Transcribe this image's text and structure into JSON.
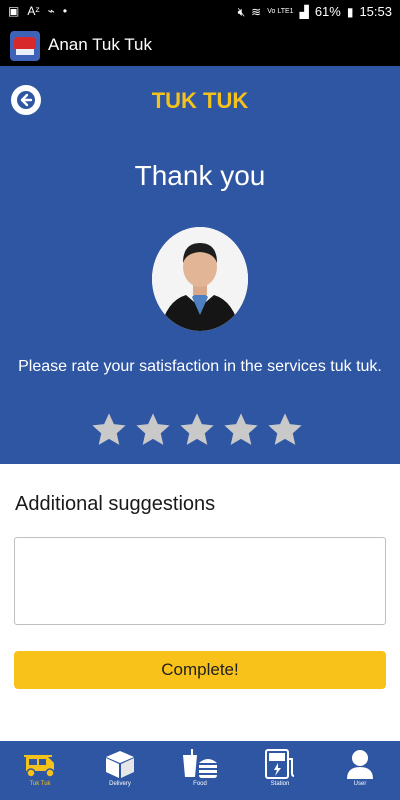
{
  "status_bar": {
    "battery": "61%",
    "time": "15:53",
    "network": "Vo LTE1"
  },
  "app_bar": {
    "title": "Anan Tuk Tuk",
    "logo_icon": "app-logo-icon"
  },
  "hero": {
    "brand_title": "TUK TUK",
    "thank_you": "Thank you",
    "rating_prompt": "Please rate your satisfaction in the services tuk tuk.",
    "rating": 0,
    "max_rating": 5,
    "star_color": "#c9c9c9",
    "background": "#2f56a2",
    "accent": "#f4c21a"
  },
  "suggestions": {
    "label": "Additional suggestions",
    "value": "",
    "placeholder": ""
  },
  "complete_button": {
    "label": "Complete!",
    "color": "#f9c21a"
  },
  "bottom_nav": {
    "items": [
      {
        "label": "Tuk Tuk",
        "icon": "tuk-tuk-icon",
        "active": true
      },
      {
        "label": "Delivery",
        "icon": "delivery-box-icon",
        "active": false
      },
      {
        "label": "Food",
        "icon": "food-icon",
        "active": false
      },
      {
        "label": "Station",
        "icon": "station-icon",
        "active": false
      },
      {
        "label": "User",
        "icon": "user-icon",
        "active": false
      }
    ]
  }
}
